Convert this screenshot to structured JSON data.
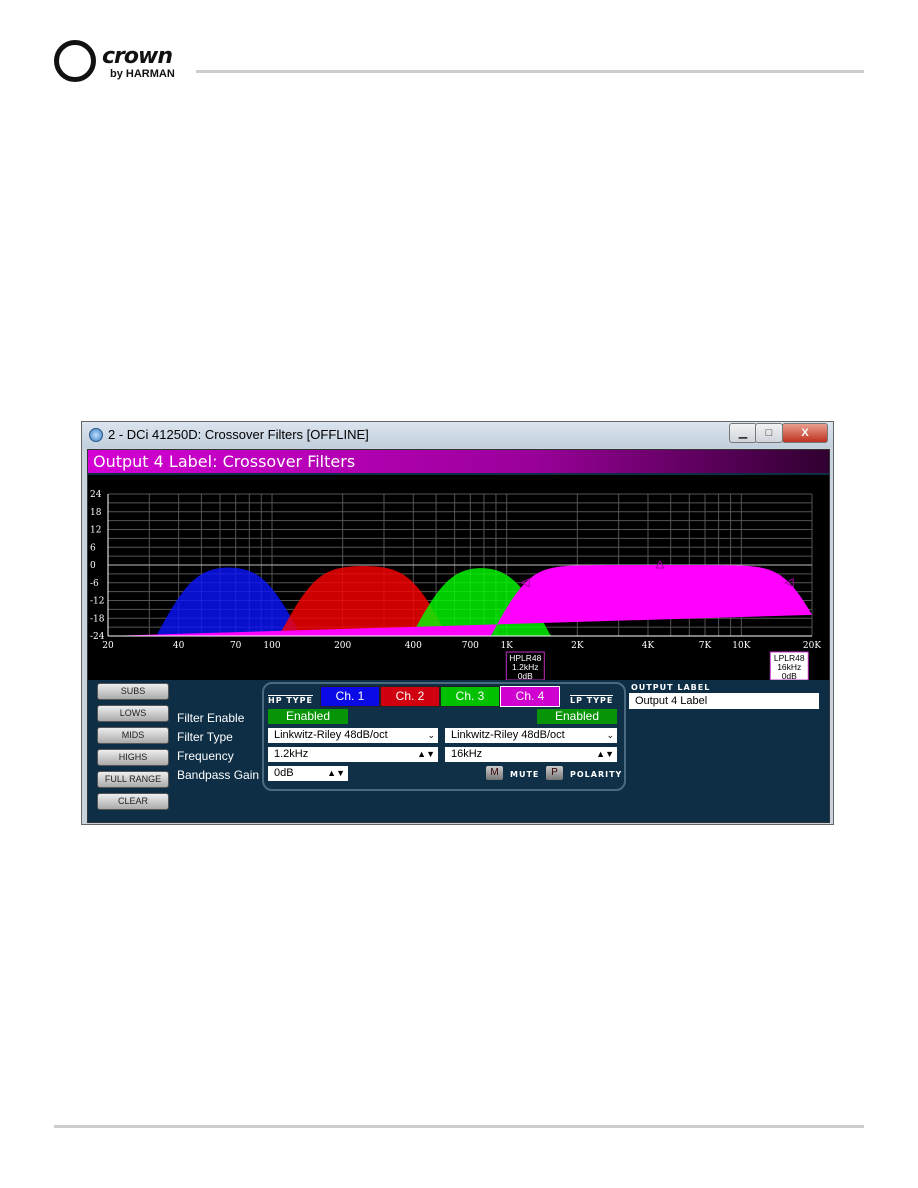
{
  "brand": {
    "name": "crown",
    "sub": "by HARMAN"
  },
  "window": {
    "title": "2 - DCi 41250D: Crossover Filters [OFFLINE]",
    "min": "▁",
    "max": "□",
    "close": "X"
  },
  "header": "Output 4 Label: Crossover Filters",
  "presets": [
    "SUBS",
    "LOWS",
    "MIDS",
    "HIGHS",
    "FULL RANGE",
    "CLEAR"
  ],
  "labels": {
    "enable": "Filter Enable",
    "type": "Filter Type",
    "freq": "Frequency",
    "gain": "Bandpass Gain",
    "hp_type": "HP TYPE",
    "lp_type": "LP TYPE",
    "mute": "MUTE",
    "polarity": "POLARITY",
    "mute_btn": "M",
    "polarity_btn": "P",
    "output_label_title": "OUTPUT LABEL"
  },
  "channels": [
    {
      "label": "Ch. 1",
      "color": "#0a0ae6"
    },
    {
      "label": "Ch. 2",
      "color": "#e00000"
    },
    {
      "label": "Ch. 3",
      "color": "#00cc00"
    },
    {
      "label": "Ch. 4",
      "color": "#e000e0"
    }
  ],
  "hp": {
    "enable": "Enabled",
    "type": "Linkwitz-Riley 48dB/oct",
    "freq": "1.2kHz"
  },
  "lp": {
    "enable": "Enabled",
    "type": "Linkwitz-Riley 48dB/oct",
    "freq": "16kHz"
  },
  "gain": "0dB",
  "output_label": "Output 4 Label",
  "chart_data": {
    "type": "area",
    "xscale": "log",
    "xlim": [
      20,
      20000
    ],
    "ylim": [
      -24,
      24
    ],
    "grid": true,
    "xticks": [
      "20",
      "40",
      "70",
      "100",
      "200",
      "400",
      "700",
      "1K",
      "2K",
      "4K",
      "7K",
      "10K",
      "20K"
    ],
    "xtick_values": [
      20,
      40,
      70,
      100,
      200,
      400,
      700,
      1000,
      2000,
      4000,
      7000,
      10000,
      20000
    ],
    "yticks": [
      24,
      18,
      12,
      6,
      0,
      -6,
      -12,
      -18,
      -24
    ],
    "series": [
      {
        "channel": "Ch. 1",
        "hp_hz": 45,
        "lp_hz": 95,
        "color": "#0a14ff"
      },
      {
        "channel": "Ch. 2",
        "hp_hz": 150,
        "lp_hz": 400,
        "color": "#ff0000"
      },
      {
        "channel": "Ch. 3",
        "hp_hz": 550,
        "lp_hz": 1100,
        "color": "#00ff00"
      },
      {
        "channel": "Ch. 4",
        "hp_hz": 1200,
        "lp_hz": 16000,
        "color": "#ff00ff"
      }
    ],
    "markers": [
      {
        "lines": [
          "HPLR48",
          "1.2kHz",
          "0dB"
        ]
      },
      {
        "lines": [
          "LPLR48",
          "16kHz",
          "0dB"
        ]
      }
    ]
  }
}
